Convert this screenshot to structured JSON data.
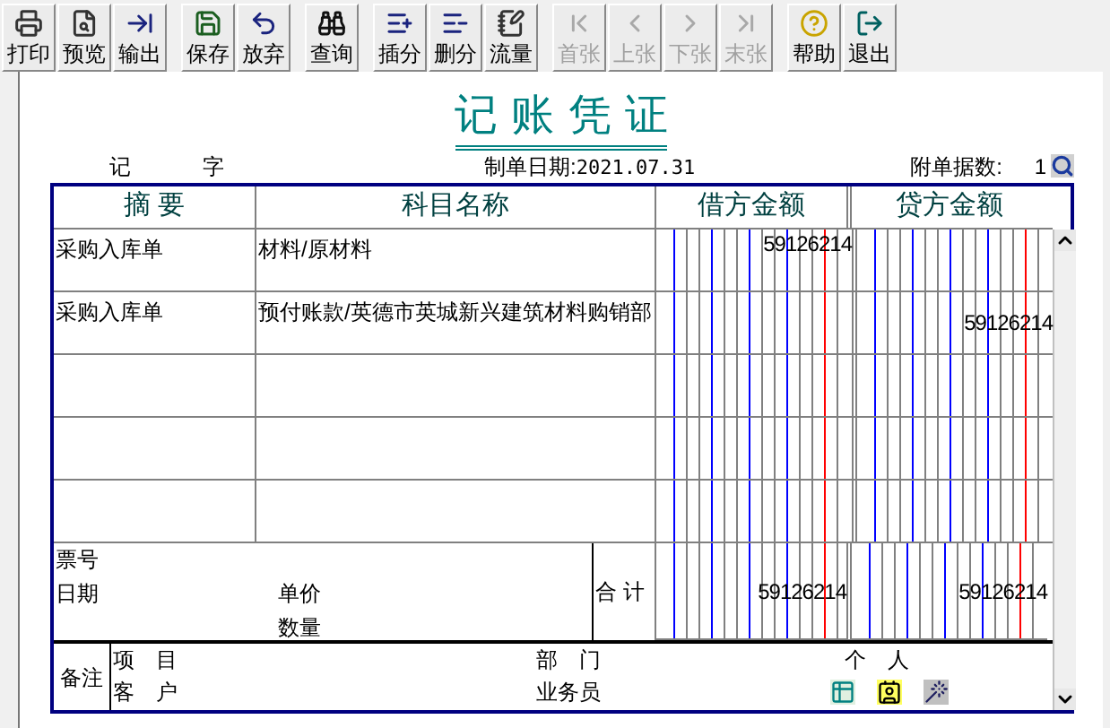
{
  "toolbar": {
    "groups": [
      [
        {
          "label": "打印",
          "disabled": false
        },
        {
          "label": "预览",
          "disabled": false
        },
        {
          "label": "输出",
          "disabled": false
        }
      ],
      [
        {
          "label": "保存",
          "disabled": false
        },
        {
          "label": "放弃",
          "disabled": false
        }
      ],
      [
        {
          "label": "查询",
          "disabled": false
        }
      ],
      [
        {
          "label": "插分",
          "disabled": false
        },
        {
          "label": "删分",
          "disabled": false
        },
        {
          "label": "流量",
          "disabled": false
        }
      ],
      [
        {
          "label": "首张",
          "disabled": true
        },
        {
          "label": "上张",
          "disabled": true
        },
        {
          "label": "下张",
          "disabled": true
        },
        {
          "label": "末张",
          "disabled": true
        }
      ],
      [
        {
          "label": "帮助",
          "disabled": false
        },
        {
          "label": "退出",
          "disabled": false
        }
      ]
    ]
  },
  "voucher": {
    "title": "记 账 凭 证",
    "type_label": "记",
    "type_suffix": "字",
    "date_label": "制单日期:",
    "date": "2021.07.31",
    "attachments_label": "附单据数:",
    "attachments": "1",
    "columns": [
      "摘 要",
      "科目名称",
      "借方金额",
      "贷方金额"
    ],
    "rows": [
      {
        "summary": "采购入库单",
        "account": "材料/原材料",
        "debit": "59126214",
        "credit": ""
      },
      {
        "summary": "采购入库单",
        "account": "预付账款/英德市英城新兴建筑材料购销部",
        "debit": "",
        "credit": "59126214"
      },
      {
        "summary": "",
        "account": "",
        "debit": "",
        "credit": ""
      },
      {
        "summary": "",
        "account": "",
        "debit": "",
        "credit": ""
      },
      {
        "summary": "",
        "account": "",
        "debit": "",
        "credit": ""
      }
    ],
    "footer": {
      "ticket_label": "票号",
      "date_label": "日期",
      "price_label": "单价",
      "qty_label": "数量",
      "total_label": "合 计",
      "debit_total": "59126214",
      "credit_total": "59126214"
    },
    "remarks": {
      "label": "备注",
      "project_label": "项　目",
      "customer_label": "客　户",
      "dept_label": "部　门",
      "salesperson_label": "业务员",
      "person_label": "个　人"
    }
  }
}
